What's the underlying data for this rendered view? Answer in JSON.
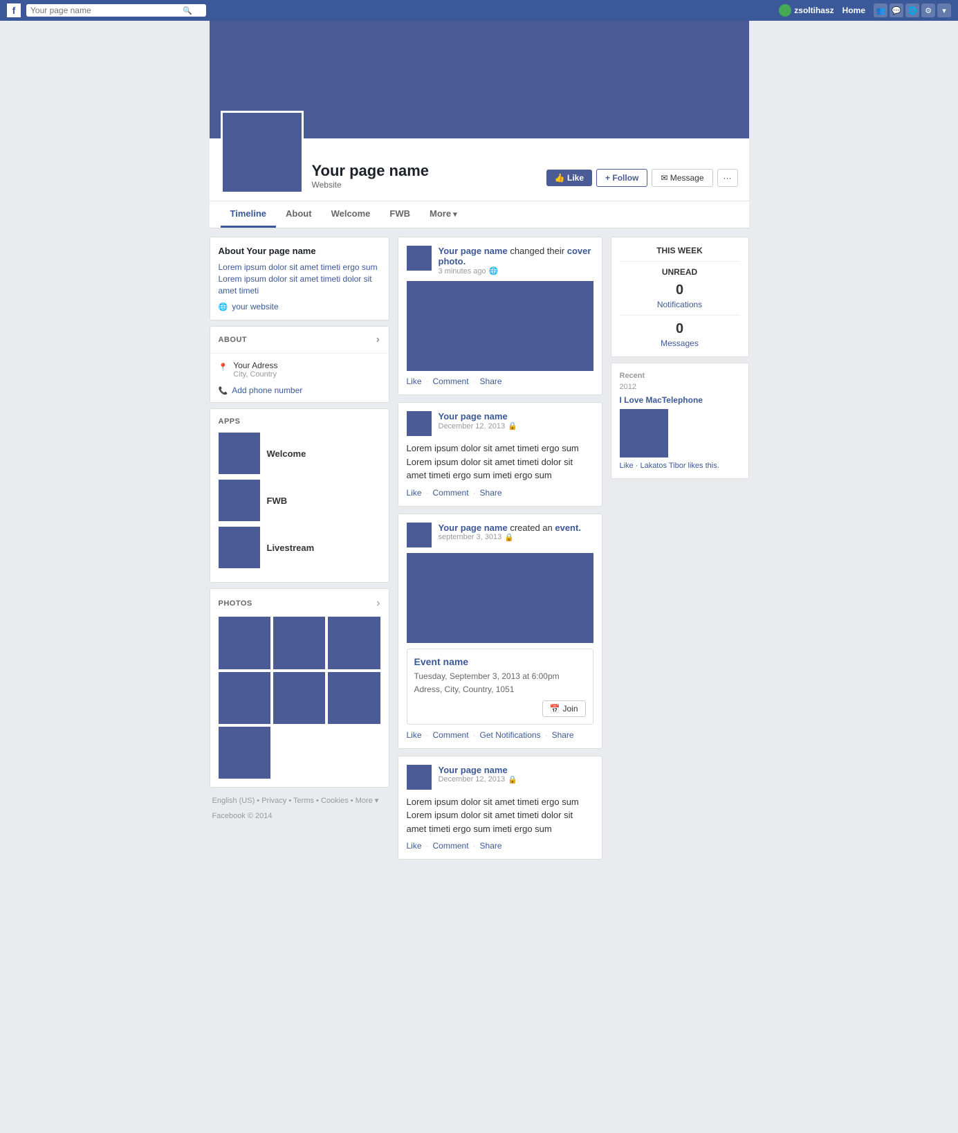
{
  "topnav": {
    "logo": "f",
    "search_placeholder": "Your page name",
    "username": "zsoltihasz",
    "home_label": "Home"
  },
  "cover": {
    "page_name": "Your page name",
    "website": "Website",
    "btn_like": "Like",
    "btn_follow": "Follow",
    "btn_message": "Message",
    "btn_more": "···"
  },
  "tabs": [
    {
      "label": "Timeline",
      "active": true
    },
    {
      "label": "About",
      "active": false
    },
    {
      "label": "Welcome",
      "active": false
    },
    {
      "label": "FWB",
      "active": false
    },
    {
      "label": "More",
      "active": false
    }
  ],
  "sidebar": {
    "about_title": "About Your page name",
    "about_desc": "Lorem ipsum dolor sit amet timeti ergo sum Lorem ipsum dolor sit amet timeti dolor sit amet timeti",
    "website": "your website",
    "about_section_label": "ABOUT",
    "address": "Your Adress",
    "city_country": "City, Country",
    "add_phone": "Add phone number",
    "apps_label": "APPS",
    "apps": [
      {
        "name": "Welcome"
      },
      {
        "name": "FWB"
      },
      {
        "name": "Livestream"
      }
    ],
    "photos_label": "PHOTOS"
  },
  "footer": {
    "links": [
      "English (US)",
      "Privacy",
      "Terms",
      "Cookies",
      "More"
    ],
    "copyright": "Facebook © 2014"
  },
  "right_panel": {
    "this_week": "THIS WEEK",
    "unread": "UNREAD",
    "notifications_count": "0",
    "notifications_label": "Notifications",
    "messages_count": "0",
    "messages_label": "Messages",
    "recent_label": "Recent",
    "recent_year": "2012",
    "page_name": "I Love MacTelephone",
    "like_text": "Like · Lakatos Tibor likes this."
  },
  "feed": {
    "posts": [
      {
        "author": "Your page name",
        "action": "changed their",
        "action2": "cover photo.",
        "time": "3 minutes ago",
        "has_image": true,
        "like": "Like",
        "comment": "Comment",
        "share": "Share"
      },
      {
        "author": "Your page name",
        "action": "",
        "action2": "",
        "time": "December 12, 2013",
        "has_image": false,
        "text": "Lorem ipsum dolor sit amet timeti ergo sum Lorem ipsum dolor sit amet timeti dolor sit amet timeti ergo sum imeti ergo sum",
        "like": "Like",
        "comment": "Comment",
        "share": "Share"
      },
      {
        "author": "Your page name",
        "action": "created an",
        "action2": "event.",
        "time": "september 3, 3013",
        "has_image": false,
        "has_event": true,
        "event_name": "Event name",
        "event_date": "Tuesday, September 3, 2013 at 6:00pm",
        "event_address": "Adress, City, Country, 1051",
        "btn_join": "Join",
        "like": "Like",
        "comment": "Comment",
        "get_notif": "Get Notifications",
        "share": "Share"
      },
      {
        "author": "Your page name",
        "action": "",
        "action2": "",
        "time": "December 12, 2013",
        "has_image": false,
        "text": "Lorem ipsum dolor sit amet timeti ergo sum Lorem ipsum dolor sit amet timeti dolor sit amet timeti ergo sum imeti ergo sum",
        "like": "Like",
        "comment": "Comment",
        "share": "Share"
      }
    ]
  }
}
